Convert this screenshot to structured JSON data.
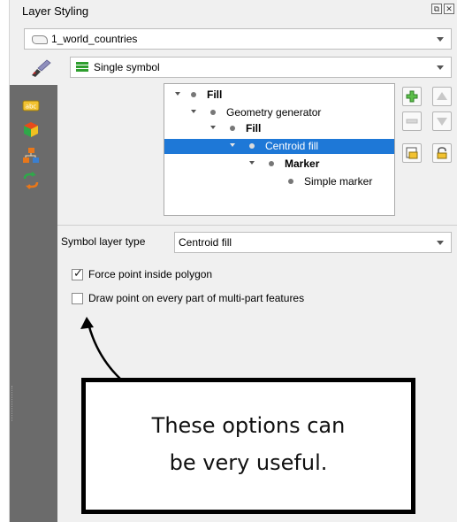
{
  "panel": {
    "title": "Layer Styling",
    "title_icons": [
      "restore-icon",
      "close-icon"
    ]
  },
  "layer_select": {
    "value": "1_world_countries",
    "icon": "polygon-layer-icon"
  },
  "renderer_select": {
    "value": "Single symbol",
    "icon": "single-symbol-icon"
  },
  "sidebar": {
    "tabs": [
      "labels-icon",
      "3d-view-icon",
      "diagrams-icon",
      "history-icon"
    ]
  },
  "symbol_tree": {
    "items": [
      {
        "label": "Fill",
        "bold": true,
        "expanded": true
      },
      {
        "label": "Geometry generator",
        "bold": false,
        "expanded": true
      },
      {
        "label": "Fill",
        "bold": true,
        "expanded": true
      },
      {
        "label": "Centroid fill",
        "bold": false,
        "expanded": true,
        "selected": true
      },
      {
        "label": "Marker",
        "bold": true,
        "expanded": true
      },
      {
        "label": "Simple marker",
        "bold": false,
        "expanded": false
      }
    ]
  },
  "toolbar": {
    "buttons": [
      "add-symbol-layer-icon",
      "move-up-icon",
      "remove-symbol-layer-icon",
      "move-down-icon",
      "duplicate-layer-icon",
      "lock-color-icon"
    ]
  },
  "symbol_layer_type": {
    "label": "Symbol layer type",
    "value": "Centroid fill"
  },
  "options": [
    {
      "label": "Force point inside polygon",
      "checked": true
    },
    {
      "label": "Draw point on every part of multi-part features",
      "checked": false
    }
  ],
  "annotation": {
    "text": "These options can\nbe very useful."
  },
  "colors": {
    "selection": "#1e78d7",
    "sidebar": "#6b6b6b",
    "panel_bg": "#f0f0f0"
  }
}
